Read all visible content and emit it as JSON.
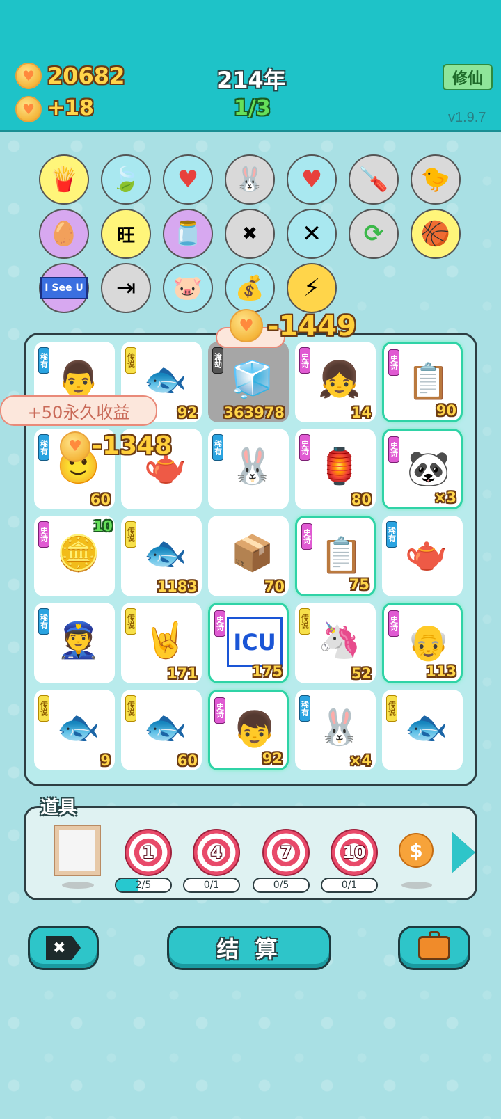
{
  "header": {
    "coins": "20682",
    "income": "+18",
    "year": "214年",
    "progress": "1/3",
    "xiuxian_label": "修仙",
    "version": "v1.9.7"
  },
  "floating": {
    "permanent_income": "+50永久收益",
    "minus_top": "-1449",
    "minus_left": "-1348",
    "bonus_ten": "10"
  },
  "circle_icons": [
    {
      "name": "fries-icon",
      "glyph": "🍟",
      "bg": "#fff57a"
    },
    {
      "name": "leaf-icon",
      "glyph": "🍃",
      "bg": "#a9e8f0"
    },
    {
      "name": "blood-fan-icon",
      "glyph": "♥",
      "bg": "#a9e8f0"
    },
    {
      "name": "rabbit-icon",
      "glyph": "🐰",
      "bg": "#d9d9d9"
    },
    {
      "name": "blood-fan-icon-2",
      "glyph": "♥",
      "bg": "#a9e8f0"
    },
    {
      "name": "screwdriver-icon",
      "glyph": "🪛",
      "bg": "#d9d9d9"
    },
    {
      "name": "chick-egg-icon",
      "glyph": "🐤",
      "bg": "#d9d9d9"
    },
    {
      "name": "egg-face-icon",
      "glyph": "🥚",
      "bg": "#d7a8f0"
    },
    {
      "name": "wang-tiles-icon",
      "glyph": "旺",
      "bg": "#fff57a"
    },
    {
      "name": "jar-icon",
      "glyph": "🫙",
      "bg": "#d7a8f0"
    },
    {
      "name": "delete-tag-icon",
      "glyph": "✖",
      "bg": "#d9d9d9"
    },
    {
      "name": "cross-sticks-icon",
      "glyph": "✕",
      "bg": "#a9e8f0"
    },
    {
      "name": "refresh-icon",
      "glyph": "⟳",
      "bg": "#d9d9d9"
    },
    {
      "name": "basketballs-icon",
      "glyph": "🏀",
      "bg": "#fff57a"
    },
    {
      "name": "i-see-u-icon",
      "glyph": "I See U",
      "bg": "#d7a8f0"
    },
    {
      "name": "skip-icon",
      "glyph": "⇥",
      "bg": "#d9d9d9"
    },
    {
      "name": "piggy-bank-icon",
      "glyph": "🐷",
      "bg": "#a9e8f0"
    },
    {
      "name": "money-bag-icon",
      "glyph": "💰",
      "bg": "#a9e8f0"
    },
    {
      "name": "lightning-icon",
      "glyph": "⚡",
      "bg": "#ffd54a"
    }
  ],
  "tiles": [
    {
      "name": "tile-teacher",
      "badge": "稀有",
      "rarity": "rare",
      "glyph": "👨",
      "num": ""
    },
    {
      "name": "tile-koi",
      "badge": "传说",
      "rarity": "legend",
      "glyph": "🐟",
      "num": "92"
    },
    {
      "name": "tile-fridge",
      "badge": "渡劫",
      "rarity": "ferry",
      "glyph": "🧊",
      "num": "363978"
    },
    {
      "name": "tile-girl",
      "badge": "史诗",
      "rarity": "epic",
      "glyph": "👧",
      "num": "14"
    },
    {
      "name": "tile-ctrl-cv",
      "badge": "史诗",
      "rarity": "epic",
      "glyph": "📋",
      "num": "90"
    },
    {
      "name": "tile-man-clover",
      "badge": "稀有",
      "rarity": "rare",
      "glyph": "🙂",
      "num": "60"
    },
    {
      "name": "tile-teapot",
      "badge": "",
      "rarity": "rare",
      "glyph": "🫖",
      "num": ""
    },
    {
      "name": "tile-rabbit",
      "badge": "稀有",
      "rarity": "rare",
      "glyph": "🐰",
      "num": ""
    },
    {
      "name": "tile-rabbit-house",
      "badge": "史诗",
      "rarity": "epic",
      "glyph": "🏮",
      "num": "80"
    },
    {
      "name": "tile-panda",
      "badge": "史诗",
      "rarity": "epic",
      "glyph": "🐼",
      "num": "×3"
    },
    {
      "name": "tile-coin-pie",
      "badge": "史诗",
      "rarity": "epic",
      "glyph": "🪙",
      "num": ""
    },
    {
      "name": "tile-koi-2",
      "badge": "传说",
      "rarity": "legend",
      "glyph": "🐟",
      "num": "1183"
    },
    {
      "name": "tile-box",
      "badge": "",
      "rarity": "",
      "glyph": "📦",
      "num": "70"
    },
    {
      "name": "tile-ctrl-cv-2",
      "badge": "史诗",
      "rarity": "epic",
      "glyph": "📋",
      "num": "75"
    },
    {
      "name": "tile-teapot-2",
      "badge": "稀有",
      "rarity": "rare",
      "glyph": "🫖",
      "num": ""
    },
    {
      "name": "tile-police",
      "badge": "稀有",
      "rarity": "rare",
      "glyph": "👮",
      "num": ""
    },
    {
      "name": "tile-rock-hand",
      "badge": "传说",
      "rarity": "legend",
      "glyph": "🤘",
      "num": "171"
    },
    {
      "name": "tile-icu",
      "badge": "史诗",
      "rarity": "epic",
      "glyph": "ICU",
      "num": "175"
    },
    {
      "name": "tile-unicorn",
      "badge": "传说",
      "rarity": "legend",
      "glyph": "🦄",
      "num": "52"
    },
    {
      "name": "tile-old-man",
      "badge": "史诗",
      "rarity": "epic",
      "glyph": "👴",
      "num": "113"
    },
    {
      "name": "tile-koi-3",
      "badge": "传说",
      "rarity": "legend",
      "glyph": "🐟",
      "num": "9"
    },
    {
      "name": "tile-koi-4",
      "badge": "传说",
      "rarity": "legend",
      "glyph": "🐟",
      "num": "60"
    },
    {
      "name": "tile-red-hat-boy",
      "badge": "史诗",
      "rarity": "epic",
      "glyph": "👦",
      "num": "92"
    },
    {
      "name": "tile-rabbit-2",
      "badge": "稀有",
      "rarity": "rare",
      "glyph": "🐰",
      "num": "×4"
    },
    {
      "name": "tile-koi-5",
      "badge": "传说",
      "rarity": "legend",
      "glyph": "🐟",
      "num": ""
    }
  ],
  "props": {
    "label": "道具",
    "items": [
      {
        "name": "frame-prop",
        "value": ""
      },
      {
        "name": "target-1-prop",
        "value": "1",
        "count": "2/5",
        "fill": 0.4
      },
      {
        "name": "target-4-prop",
        "value": "4",
        "count": "0/1",
        "fill": 0
      },
      {
        "name": "target-7-prop",
        "value": "7",
        "count": "0/5",
        "fill": 0
      },
      {
        "name": "target-10-prop",
        "value": "10",
        "count": "0/1",
        "fill": 0
      },
      {
        "name": "dollar-coin-prop",
        "value": "$"
      }
    ]
  },
  "bottom": {
    "settle_label": "结 算"
  }
}
